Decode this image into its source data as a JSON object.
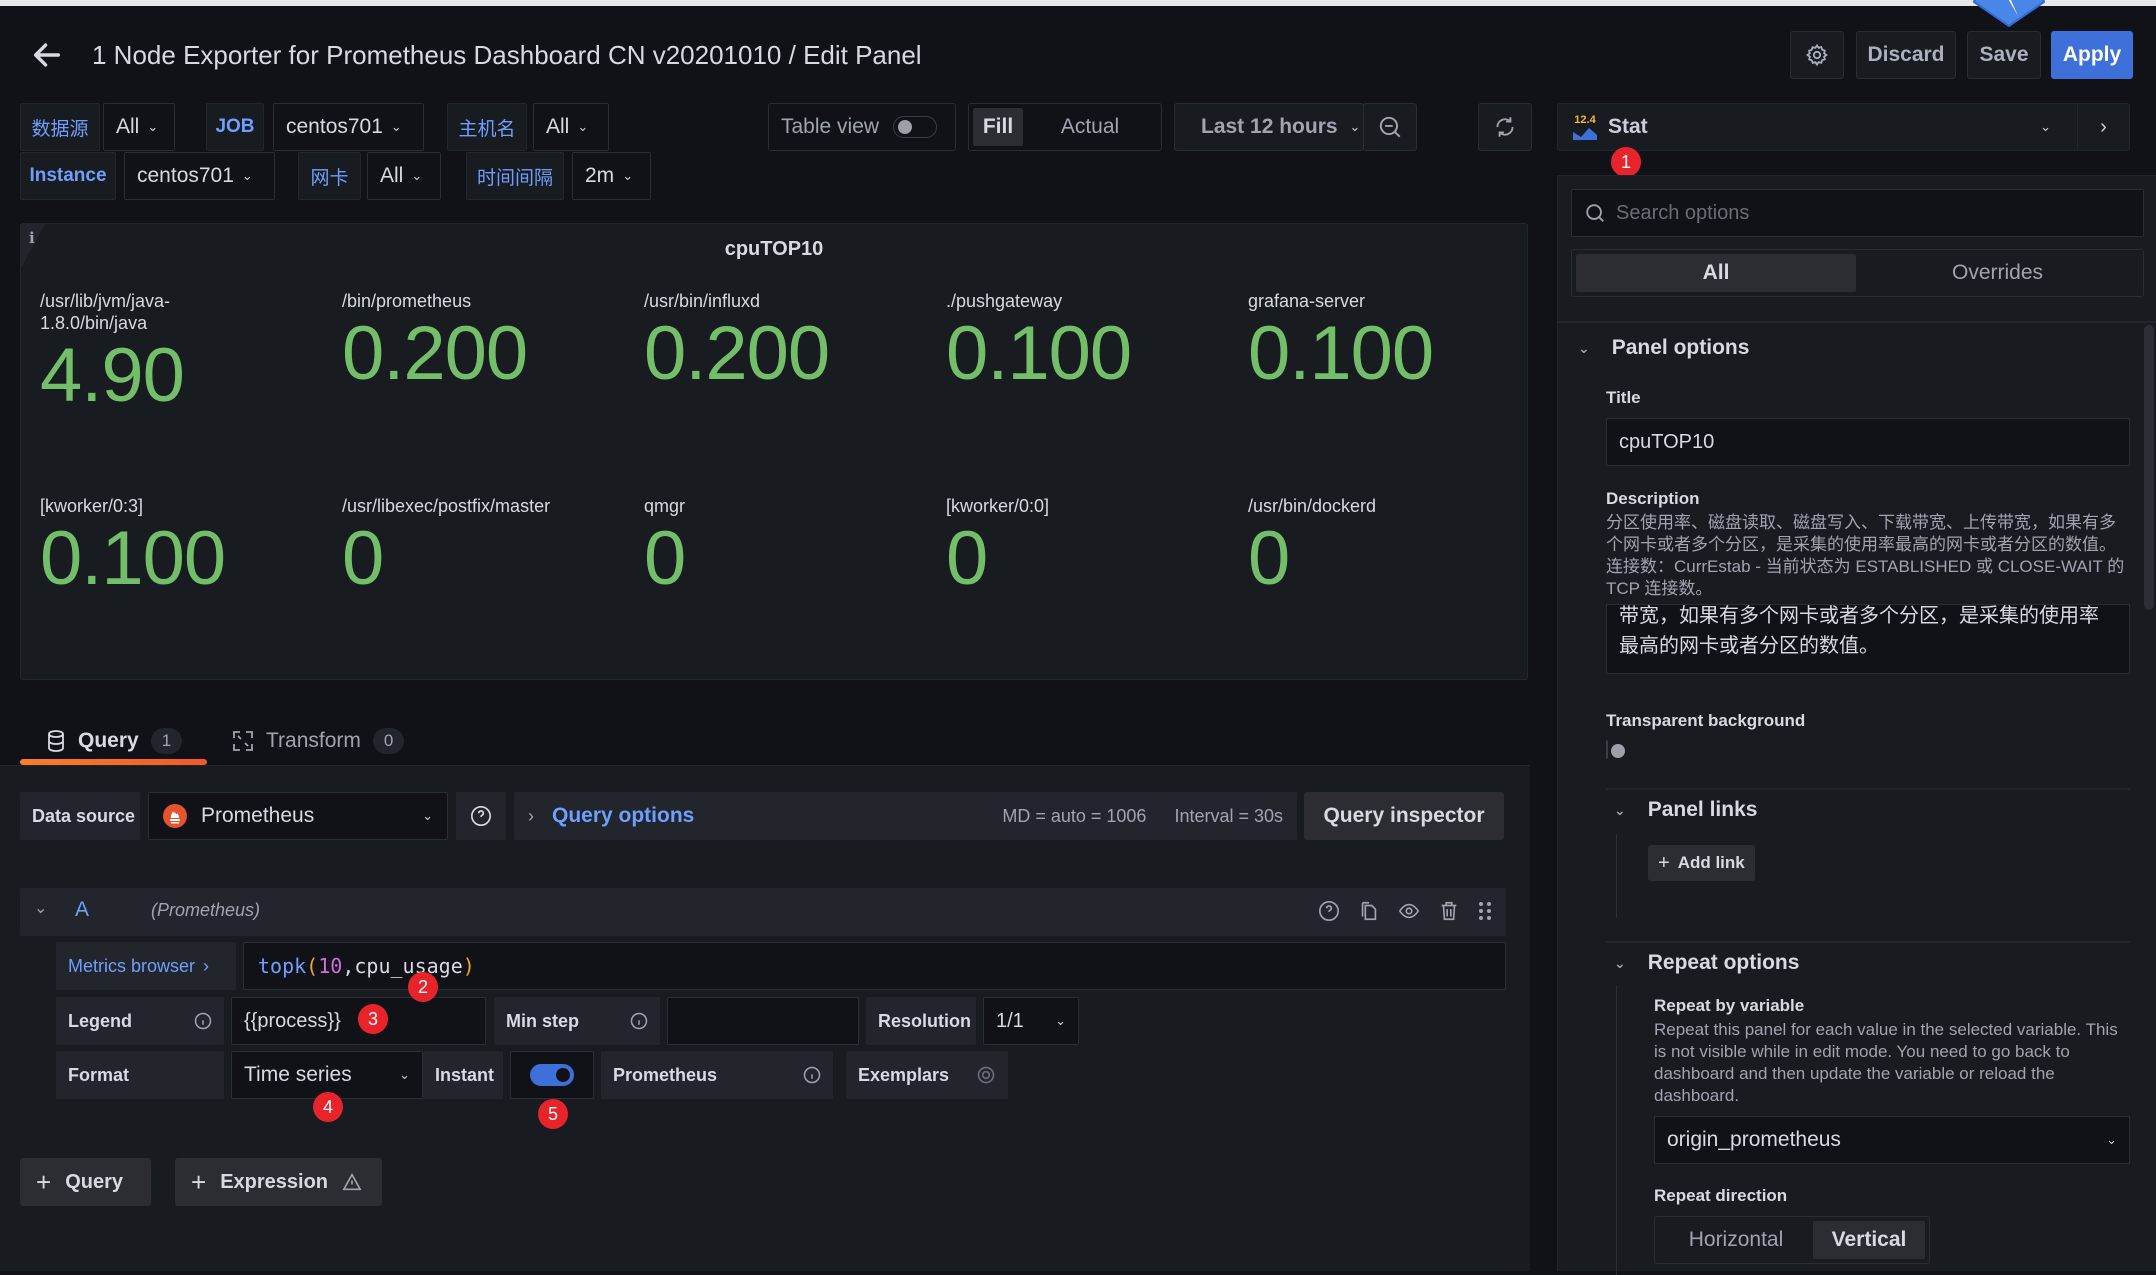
{
  "header": {
    "title": "1 Node Exporter for Prometheus Dashboard CN v20201010 / Edit Panel",
    "discard": "Discard",
    "save": "Save",
    "apply": "Apply",
    "apply_color": "#3d71d9"
  },
  "variables": [
    {
      "label": "数据源",
      "value": "All"
    },
    {
      "label": "JOB",
      "value": "centos701"
    },
    {
      "label": "主机名",
      "value": "All"
    },
    {
      "label": "Instance",
      "value": "centos701"
    },
    {
      "label": "网卡",
      "value": "All"
    },
    {
      "label": "时间间隔",
      "value": "2m"
    }
  ],
  "toolbar": {
    "table_view": "Table view",
    "table_view_on": false,
    "fill": "Fill",
    "actual": "Actual",
    "time_range": "Last 12 hours"
  },
  "viz": {
    "icon_text": "12.4",
    "name": "Stat"
  },
  "panel": {
    "title": "cpuTOP10",
    "value_color": "#73bf69",
    "stats": [
      {
        "name": "/usr/lib/jvm/java-1.8.0/bin/java",
        "value": "4.90"
      },
      {
        "name": "/bin/prometheus",
        "value": "0.200"
      },
      {
        "name": "/usr/bin/influxd",
        "value": "0.200"
      },
      {
        "name": "./pushgateway",
        "value": "0.100"
      },
      {
        "name": "grafana-server",
        "value": "0.100"
      },
      {
        "name": "[kworker/0:3]",
        "value": "0.100"
      },
      {
        "name": "/usr/libexec/postfix/master",
        "value": "0"
      },
      {
        "name": "qmgr",
        "value": "0"
      },
      {
        "name": "[kworker/0:0]",
        "value": "0"
      },
      {
        "name": "/usr/bin/dockerd",
        "value": "0"
      }
    ]
  },
  "tabs": [
    {
      "label": "Query",
      "count": "1"
    },
    {
      "label": "Transform",
      "count": "0"
    }
  ],
  "query": {
    "datasource_label": "Data source",
    "datasource": "Prometheus",
    "query_options": "Query options",
    "md": "MD = auto = 1006",
    "interval": "Interval = 30s",
    "inspector": "Query inspector",
    "ref_id": "A",
    "ref_ds": "(Prometheus)",
    "metrics_browser": "Metrics browser",
    "expr": {
      "fn": "topk",
      "open": "(",
      "num": "10",
      "comma": ",",
      "metric": "cpu_usage",
      "close": ")"
    },
    "legend_label": "Legend",
    "legend_value": "{{process}}",
    "minstep_label": "Min step",
    "minstep_value": "",
    "resolution_label": "Resolution",
    "resolution_value": "1/1",
    "format_label": "Format",
    "format_value": "Time series",
    "instant_label": "Instant",
    "instant_on": true,
    "prometheus_label": "Prometheus",
    "exemplars_label": "Exemplars",
    "add_query": "Query",
    "add_expression": "Expression"
  },
  "annotations": [
    "1",
    "2",
    "3",
    "4",
    "5"
  ],
  "options": {
    "search_placeholder": "Search options",
    "tab_all": "All",
    "tab_overrides": "Overrides",
    "panel_options": "Panel options",
    "title_label": "Title",
    "title_value": "cpuTOP10",
    "description_label": "Description",
    "description_help": "分区使用率、磁盘读取、磁盘写入、下载带宽、上传带宽，如果有多个网卡或者多个分区，是采集的使用率最高的网卡或者分区的数值。 连接数：CurrEstab - 当前状态为 ESTABLISHED 或 CLOSE-WAIT 的 TCP 连接数。",
    "description_value": "带宽，如果有多个网卡或者多个分区，是采集的使用率最高的网卡或者分区的数值。",
    "transparent_label": "Transparent background",
    "transparent_on": false,
    "panel_links": "Panel links",
    "add_link": "Add link",
    "repeat_options": "Repeat options",
    "repeat_by_label": "Repeat by variable",
    "repeat_by_help": "Repeat this panel for each value in the selected variable. This is not visible while in edit mode. You need to go back to dashboard and then update the variable or reload the dashboard.",
    "repeat_by_value": "origin_prometheus",
    "repeat_dir_label": "Repeat direction",
    "dir_horizontal": "Horizontal",
    "dir_vertical": "Vertical",
    "dir_selected": "Vertical"
  }
}
